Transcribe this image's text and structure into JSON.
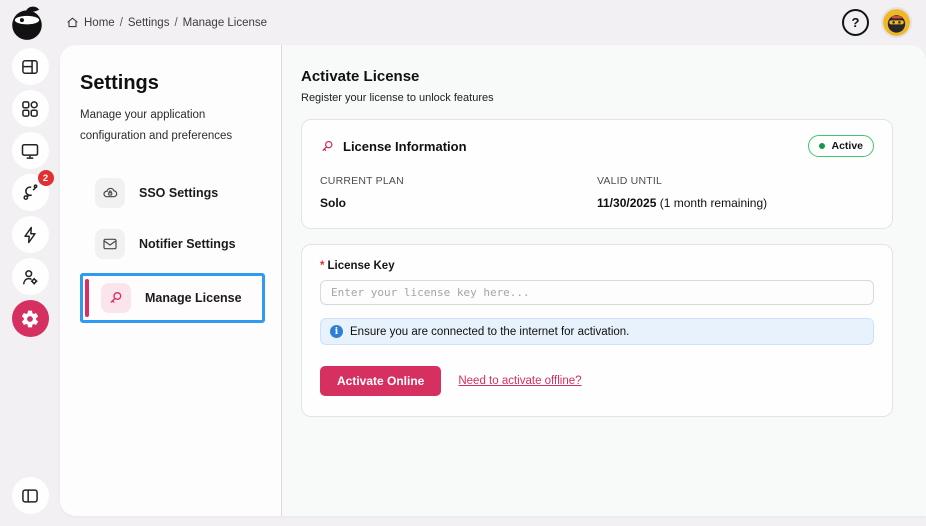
{
  "topbar": {
    "breadcrumb": {
      "items": [
        "Home",
        "Settings",
        "Manage License"
      ],
      "separator": "/"
    },
    "help_glyph": "?"
  },
  "rail": {
    "notification_badge": "2"
  },
  "sidebar": {
    "title": "Settings",
    "subtitle": "Manage your application configuration and preferences",
    "items": [
      {
        "label": "SSO Settings"
      },
      {
        "label": "Notifier Settings"
      },
      {
        "label": "Manage License"
      }
    ]
  },
  "main": {
    "title": "Activate License",
    "subtitle": "Register your license to unlock features",
    "license_info": {
      "title": "License Information",
      "status_label": "Active",
      "current_plan_label": "CURRENT PLAN",
      "current_plan_value": "Solo",
      "valid_until_label": "VALID UNTIL",
      "valid_until_value": "11/30/2025",
      "valid_until_note": "(1 month remaining)"
    },
    "activation": {
      "required_marker": "*",
      "license_key_label": "License Key",
      "license_key_placeholder": "Enter your license key here...",
      "license_key_value": "",
      "info_icon_glyph": "i",
      "info_message": "Ensure you are connected to the internet for activation.",
      "activate_button_label": "Activate Online",
      "offline_link_label": "Need to activate offline?"
    }
  },
  "colors": {
    "accent_crimson": "#d63061",
    "focus_ring_blue": "#2e9bf0",
    "status_active_green": "#3fc768",
    "info_blue": "#2f80d4",
    "badge_red": "#e03131",
    "avatar_yellow": "#f0b828"
  }
}
